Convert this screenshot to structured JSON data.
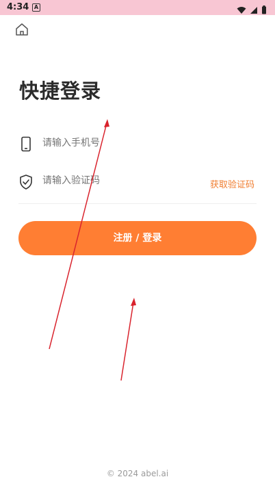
{
  "status_bar": {
    "time": "4:34",
    "notif_glyph": "A"
  },
  "header": {
    "home_icon": "home-icon"
  },
  "title": "快捷登录",
  "phone": {
    "placeholder": "请输入手机号"
  },
  "code": {
    "placeholder": "请输入验证码",
    "get_code_label": "获取验证码"
  },
  "submit_label": "注册 / 登录",
  "footer": "© 2024 abel.ai",
  "colors": {
    "accent": "#ff7e33",
    "link": "#f07d2f",
    "statusbar": "#f8c6d3",
    "arrow": "#d9232d"
  }
}
